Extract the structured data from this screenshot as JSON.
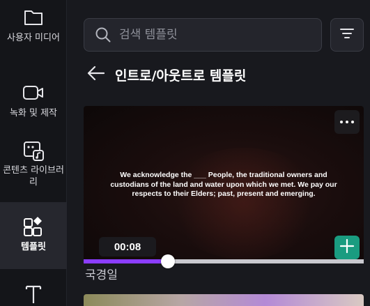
{
  "sidebar": {
    "items": [
      {
        "label": "사용자 미디어",
        "icon": "folder-icon"
      },
      {
        "label": "녹화 및 제작",
        "icon": "camera-icon"
      },
      {
        "label": "콘텐츠 라이브러리",
        "icon": "media-library-icon"
      },
      {
        "label": "템플릿",
        "icon": "templates-icon",
        "active": true
      },
      {
        "label": "",
        "icon": "text-icon"
      }
    ]
  },
  "search": {
    "placeholder": "검색 템플릿",
    "value": ""
  },
  "section": {
    "title": "인트로/아웃트로 템플릿"
  },
  "card": {
    "acknowledgement": "We acknowledge the ___ People, the traditional owners and custodians of the land and water upon which we met. We pay our respects to their Elders; past, present and emerging.",
    "duration": "00:08",
    "title": "국경일",
    "progress": 0.3
  },
  "colors": {
    "accent": "#8b3dff",
    "add": "#1a9c80",
    "bg": "#18191e"
  }
}
